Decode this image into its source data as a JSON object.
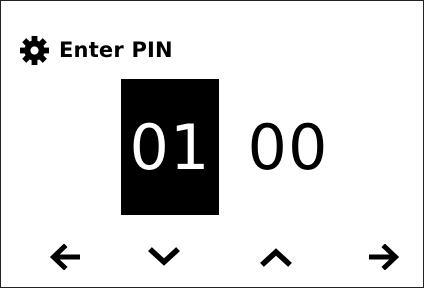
{
  "header": {
    "icon": "gear-icon",
    "title": "Enter PIN"
  },
  "pin": {
    "digits": [
      "01",
      "00"
    ],
    "active_index": 0
  },
  "navigation": [
    {
      "icon": "arrow-left-icon",
      "action": "previous-field"
    },
    {
      "icon": "chevron-down-icon",
      "action": "decrement"
    },
    {
      "icon": "chevron-up-icon",
      "action": "increment"
    },
    {
      "icon": "arrow-right-icon",
      "action": "next-field"
    }
  ],
  "colors": {
    "background": "#ffffff",
    "foreground": "#000000",
    "active_field_background": "#000000",
    "active_field_text": "#ffffff"
  }
}
